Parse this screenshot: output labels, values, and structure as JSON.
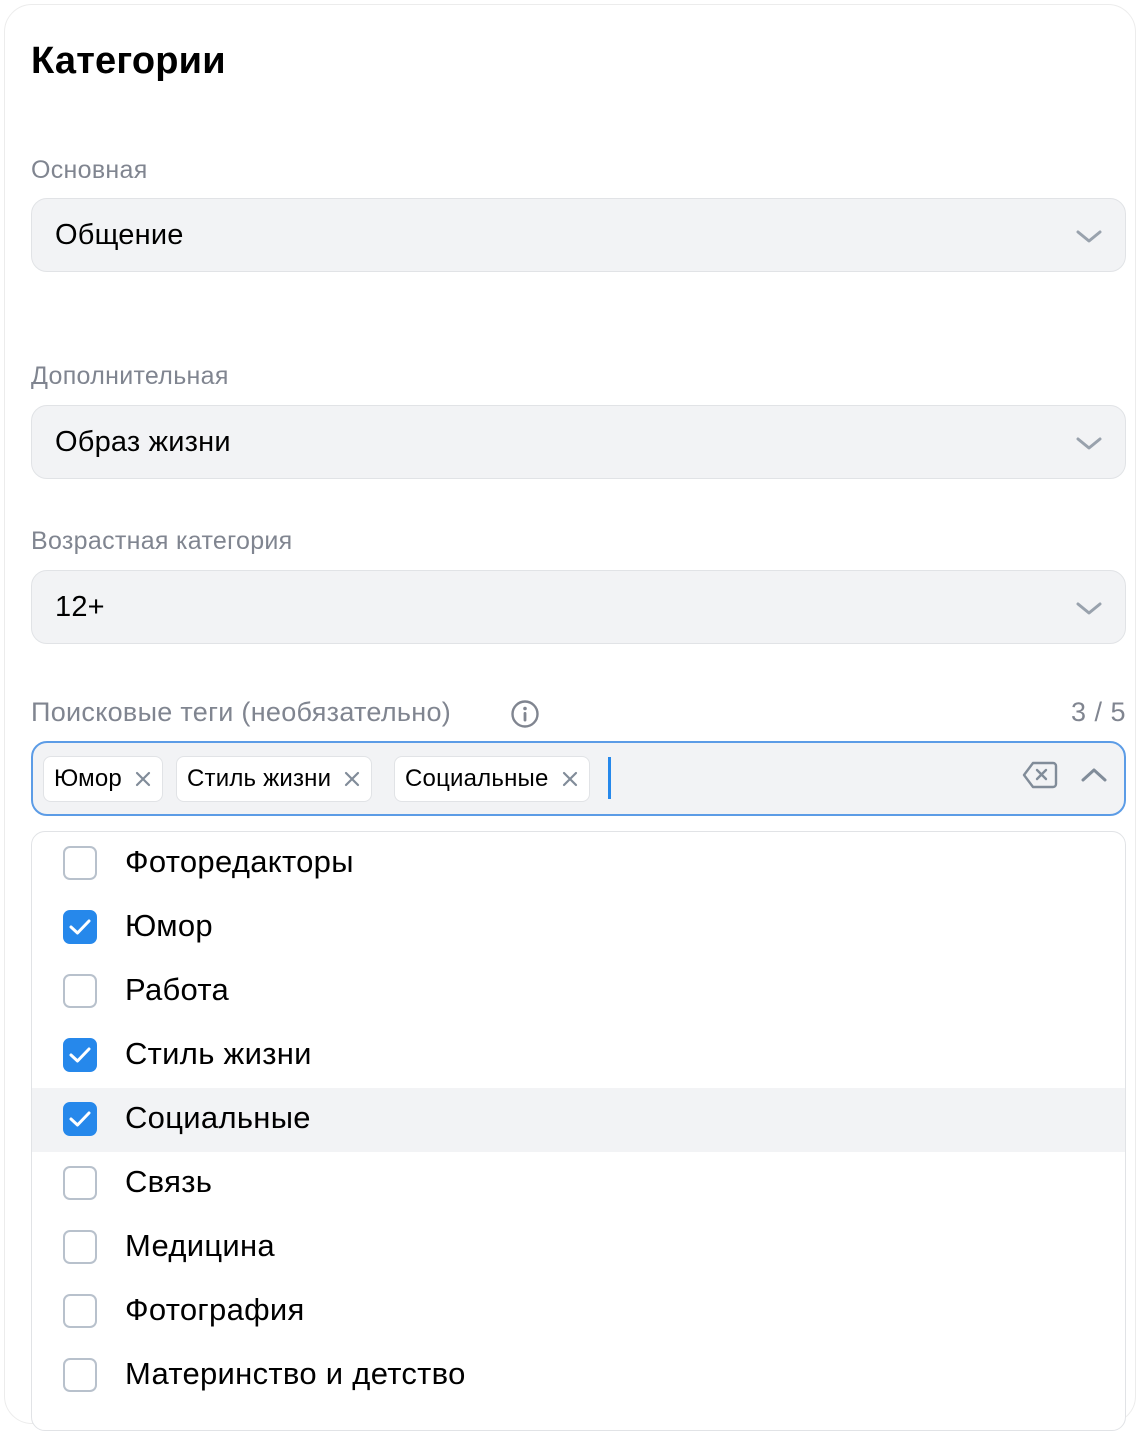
{
  "title": "Категории",
  "primary": {
    "label": "Основная",
    "value": "Общение"
  },
  "secondary": {
    "label": "Дополнительная",
    "value": "Образ жизни"
  },
  "age": {
    "label": "Возрастная категория",
    "value": "12+"
  },
  "tags": {
    "label": "Поисковые теги (необязательно)",
    "counter": "3 / 5",
    "selected": [
      "Юмор",
      "Стиль жизни",
      "Социальные"
    ],
    "options": [
      {
        "label": "Фоторедакторы",
        "checked": false
      },
      {
        "label": "Юмор",
        "checked": true
      },
      {
        "label": "Работа",
        "checked": false
      },
      {
        "label": "Стиль жизни",
        "checked": true
      },
      {
        "label": "Социальные",
        "checked": true,
        "hovered": true
      },
      {
        "label": "Связь",
        "checked": false
      },
      {
        "label": "Медицина",
        "checked": false
      },
      {
        "label": "Фотография",
        "checked": false
      },
      {
        "label": "Материнство и детство",
        "checked": false
      }
    ]
  },
  "colors": {
    "accent": "#2688eb",
    "field_bg": "#f2f3f5",
    "secondary_text": "#808590"
  },
  "icons": {
    "chevron": "chevron-down-icon",
    "info": "info-icon",
    "clear": "clear-tags-icon",
    "collapse": "chevron-up-icon",
    "remove": "close-icon"
  }
}
